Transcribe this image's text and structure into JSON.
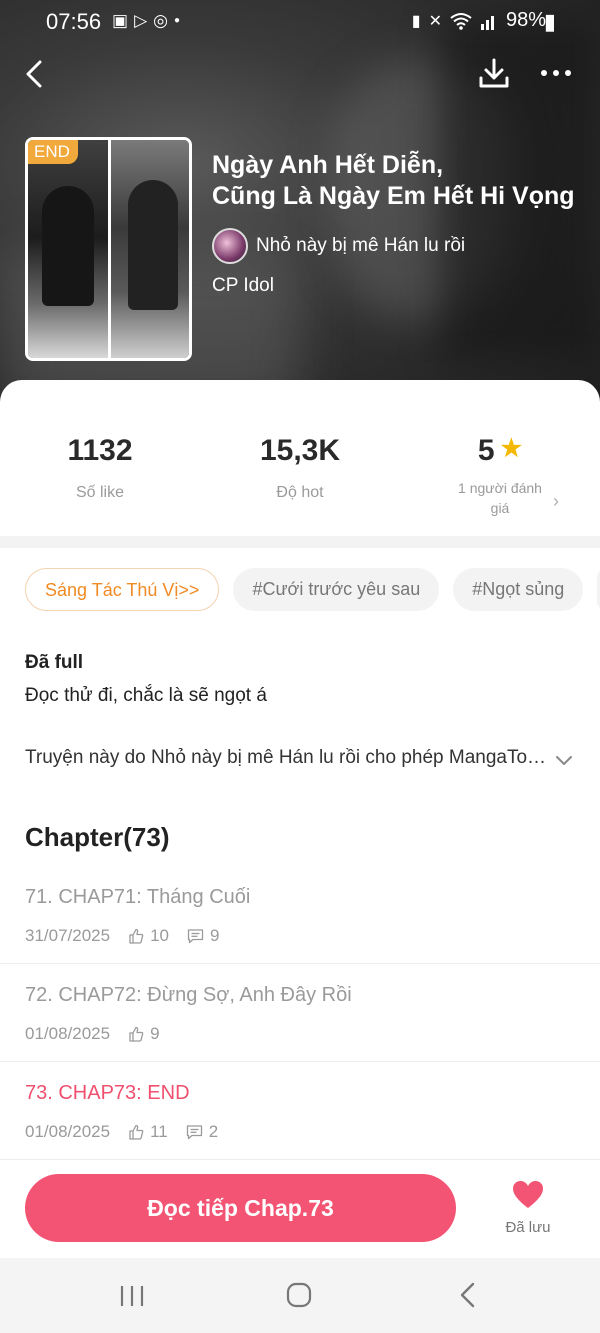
{
  "status_bar": {
    "time": "07:56",
    "battery": "98%"
  },
  "book": {
    "badge": "END",
    "title_line1": "Ngày Anh Hết Diễn,",
    "title_line2": "Cũng Là Ngày Em Hết Hi Vọng",
    "author": "Nhỏ này bị mê Hán lu rồi",
    "category": "CP Idol"
  },
  "stats": {
    "likes": {
      "value": "1132",
      "label": "Số like"
    },
    "hot": {
      "value": "15,3K",
      "label": "Độ hot"
    },
    "rating": {
      "value": "5",
      "label_line1": "1 người đánh",
      "label_line2": "giá"
    }
  },
  "tags": [
    "Sáng Tác Thú Vị>>",
    "#Cưới trước yêu sau",
    "#Ngọt sủng"
  ],
  "description": {
    "status": "Đã full",
    "line1": "Đọc thử đi, chắc là sẽ ngọt á",
    "line2": "Truyện này do Nhỏ này bị mê Hán lu rồi cho phép MangaToon đăng tải"
  },
  "chapters": {
    "heading": "Chapter(73)",
    "items": [
      {
        "name": "71. CHAP71: Tháng Cuối",
        "date": "31/07/2025",
        "likes": "10",
        "comments": "9"
      },
      {
        "name": "72. CHAP72: Đừng Sợ, Anh Đây Rồi",
        "date": "01/08/2025",
        "likes": "9",
        "comments": ""
      },
      {
        "name": "73. CHAP73: END",
        "date": "01/08/2025",
        "likes": "11",
        "comments": "2"
      }
    ]
  },
  "actions": {
    "continue_label": "Đọc tiếp Chap.73",
    "saved_label": "Đã lưu"
  },
  "colors": {
    "accent": "#f45473",
    "current_chapter": "#f0506e",
    "star": "#f5b800",
    "end_badge": "#f2a93b"
  }
}
